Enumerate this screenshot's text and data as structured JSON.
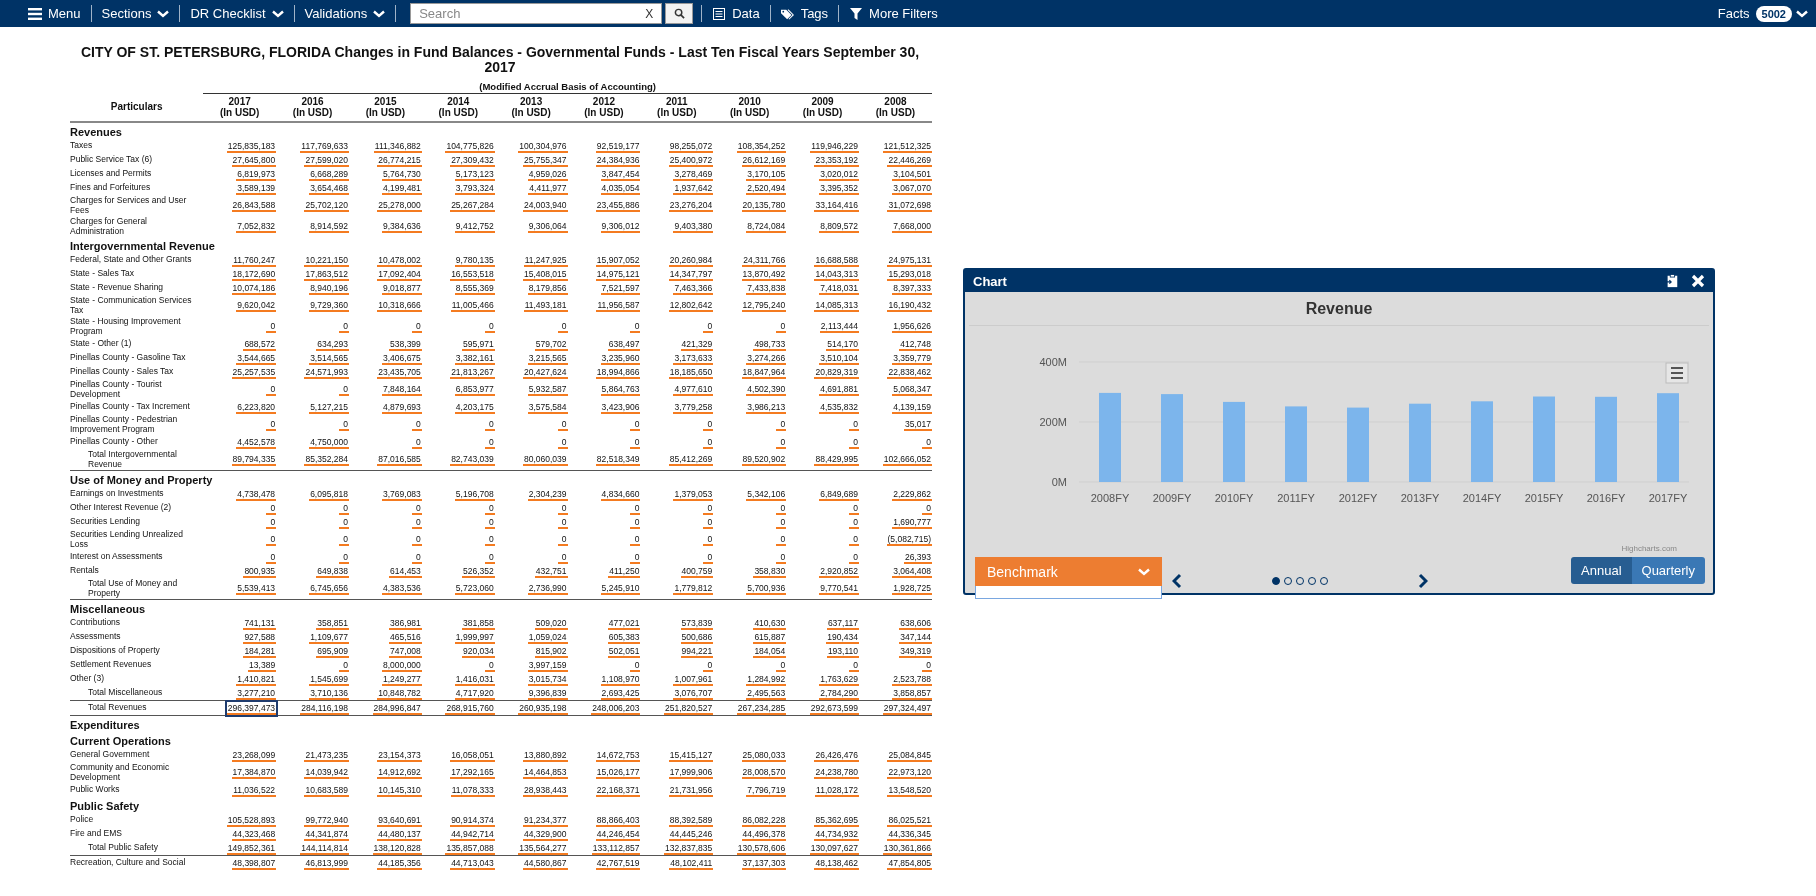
{
  "toolbar": {
    "menu": "Menu",
    "dropdowns": [
      {
        "label": "Sections"
      },
      {
        "label": "DR Checklist"
      },
      {
        "label": "Validations"
      }
    ],
    "search": {
      "placeholder": "Search",
      "clear": "X"
    },
    "links": [
      {
        "kind": "data",
        "label": "Data"
      },
      {
        "kind": "tags",
        "label": "Tags"
      },
      {
        "kind": "filter",
        "label": "More Filters"
      }
    ],
    "facts": {
      "label": "Facts",
      "count": "5002"
    }
  },
  "report": {
    "title": "CITY OF ST. PETERSBURG, FLORIDA Changes in Fund Balances - Governmental Funds - Last Ten Fiscal Years September 30, 2017",
    "subtitle": "(Modified Accrual Basis of Accounting)"
  },
  "table": {
    "label_header": "Particulars",
    "columns": [
      {
        "year": "2017",
        "unit": "(In USD)"
      },
      {
        "year": "2016",
        "unit": "(In USD)"
      },
      {
        "year": "2015",
        "unit": "(In USD)"
      },
      {
        "year": "2014",
        "unit": "(In USD)"
      },
      {
        "year": "2013",
        "unit": "(In USD)"
      },
      {
        "year": "2012",
        "unit": "(In USD)"
      },
      {
        "year": "2011",
        "unit": "(In USD)"
      },
      {
        "year": "2010",
        "unit": "(In USD)"
      },
      {
        "year": "2009",
        "unit": "(In USD)"
      },
      {
        "year": "2008",
        "unit": "(In USD)"
      }
    ],
    "rows": [
      {
        "kind": "section",
        "label": "Revenues"
      },
      {
        "kind": "item",
        "label": "Taxes",
        "selected": false,
        "values": [
          "125,835,183",
          "117,769,633",
          "111,346,882",
          "104,775,826",
          "100,304,976",
          "92,519,177",
          "98,255,072",
          "108,354,252",
          "119,946,229",
          "121,512,325"
        ]
      },
      {
        "kind": "item",
        "label": "Public Service Tax (6)",
        "selected": false,
        "values": [
          "27,645,800",
          "27,599,020",
          "26,774,215",
          "27,309,432",
          "25,755,347",
          "24,384,936",
          "25,400,972",
          "26,612,169",
          "23,353,192",
          "22,446,269"
        ]
      },
      {
        "kind": "item",
        "label": "Licenses and Permits",
        "selected": false,
        "values": [
          "6,819,973",
          "6,668,289",
          "5,764,730",
          "5,173,123",
          "4,959,026",
          "3,847,454",
          "3,278,469",
          "3,170,105",
          "3,020,012",
          "3,104,501"
        ]
      },
      {
        "kind": "item",
        "label": "Fines and Forfeitures",
        "selected": false,
        "values": [
          "3,589,139",
          "3,654,468",
          "4,199,481",
          "3,793,324",
          "4,411,977",
          "4,035,054",
          "1,937,642",
          "2,520,494",
          "3,395,352",
          "3,067,070"
        ]
      },
      {
        "kind": "item",
        "label": "Charges for Services and User Fees",
        "selected": false,
        "values": [
          "26,843,588",
          "25,702,120",
          "25,278,000",
          "25,267,284",
          "24,003,940",
          "23,455,886",
          "23,276,204",
          "20,135,780",
          "33,164,416",
          "31,072,698"
        ]
      },
      {
        "kind": "item",
        "label": "Charges for General Administration",
        "selected": false,
        "values": [
          "7,052,832",
          "8,914,592",
          "9,384,636",
          "9,412,752",
          "9,306,064",
          "9,306,012",
          "9,403,380",
          "8,724,084",
          "8,809,572",
          "7,668,000"
        ]
      },
      {
        "kind": "section",
        "label": "Intergovernmental Revenue"
      },
      {
        "kind": "item",
        "label": "Federal, State and Other Grants",
        "selected": false,
        "values": [
          "11,760,247",
          "10,221,150",
          "10,478,002",
          "9,780,135",
          "11,247,925",
          "15,907,052",
          "20,260,984",
          "24,311,766",
          "16,688,588",
          "24,975,131"
        ]
      },
      {
        "kind": "item",
        "label": "State - Sales Tax",
        "selected": false,
        "values": [
          "18,172,690",
          "17,863,512",
          "17,092,404",
          "16,553,518",
          "15,408,015",
          "14,975,121",
          "14,347,797",
          "13,870,492",
          "14,043,313",
          "15,293,018"
        ]
      },
      {
        "kind": "item",
        "label": "State - Revenue Sharing",
        "selected": false,
        "values": [
          "10,074,186",
          "8,940,196",
          "9,018,877",
          "8,555,369",
          "8,179,856",
          "7,521,597",
          "7,463,366",
          "7,433,838",
          "7,418,031",
          "8,397,333"
        ]
      },
      {
        "kind": "item",
        "label": "State - Communication Services Tax",
        "selected": false,
        "values": [
          "9,620,042",
          "9,729,360",
          "10,318,666",
          "11,005,466",
          "11,493,181",
          "11,956,587",
          "12,802,642",
          "12,795,240",
          "14,085,313",
          "16,190,432"
        ]
      },
      {
        "kind": "item",
        "label": "State - Housing Improvement Program",
        "selected": false,
        "values": [
          "0",
          "0",
          "0",
          "0",
          "0",
          "0",
          "0",
          "0",
          "2,113,444",
          "1,956,626"
        ]
      },
      {
        "kind": "item",
        "label": "State - Other (1)",
        "selected": false,
        "values": [
          "688,572",
          "634,293",
          "538,399",
          "595,971",
          "579,702",
          "638,497",
          "421,329",
          "498,733",
          "514,170",
          "412,748"
        ]
      },
      {
        "kind": "item",
        "label": "Pinellas County - Gasoline Tax",
        "selected": false,
        "values": [
          "3,544,665",
          "3,514,565",
          "3,406,675",
          "3,382,161",
          "3,215,565",
          "3,235,960",
          "3,173,633",
          "3,274,266",
          "3,510,104",
          "3,359,779"
        ]
      },
      {
        "kind": "item",
        "label": "Pinellas County - Sales Tax",
        "selected": false,
        "values": [
          "25,257,535",
          "24,571,993",
          "23,435,705",
          "21,813,267",
          "20,427,624",
          "18,994,866",
          "18,185,650",
          "18,847,964",
          "20,829,319",
          "22,838,462"
        ]
      },
      {
        "kind": "item",
        "label": "Pinellas County - Tourist Development",
        "selected": false,
        "values": [
          "0",
          "0",
          "7,848,164",
          "6,853,977",
          "5,932,587",
          "5,864,763",
          "4,977,610",
          "4,502,390",
          "4,691,881",
          "5,068,347"
        ]
      },
      {
        "kind": "item",
        "label": "Pinellas County - Tax Increment",
        "selected": false,
        "values": [
          "6,223,820",
          "5,127,215",
          "4,879,693",
          "4,203,175",
          "3,575,584",
          "3,423,906",
          "3,779,258",
          "3,986,213",
          "4,535,832",
          "4,139,159"
        ]
      },
      {
        "kind": "item",
        "label": "Pinellas County - Pedestrian Improvement Program",
        "selected": false,
        "values": [
          "0",
          "0",
          "0",
          "0",
          "0",
          "0",
          "0",
          "0",
          "0",
          "35,017"
        ]
      },
      {
        "kind": "item",
        "label": "Pinellas County - Other",
        "selected": false,
        "values": [
          "4,452,578",
          "4,750,000",
          "0",
          "0",
          "0",
          "0",
          "0",
          "0",
          "0",
          "0"
        ]
      },
      {
        "kind": "total",
        "label": "Total Intergovernmental Revenue",
        "selected": false,
        "values": [
          "89,794,335",
          "85,352,284",
          "87,016,585",
          "82,743,039",
          "80,060,039",
          "82,518,349",
          "85,412,269",
          "89,520,902",
          "88,429,995",
          "102,666,052"
        ]
      },
      {
        "kind": "section",
        "label": "Use of Money and Property"
      },
      {
        "kind": "item",
        "label": "Earnings on Investments",
        "selected": false,
        "values": [
          "4,738,478",
          "6,095,818",
          "3,769,083",
          "5,196,708",
          "2,304,239",
          "4,834,660",
          "1,379,053",
          "5,342,106",
          "6,849,689",
          "2,229,862"
        ]
      },
      {
        "kind": "item",
        "label": "Other Interest Revenue (2)",
        "selected": false,
        "values": [
          "0",
          "0",
          "0",
          "0",
          "0",
          "0",
          "0",
          "0",
          "0",
          "0"
        ]
      },
      {
        "kind": "item",
        "label": "Securities Lending",
        "selected": false,
        "values": [
          "0",
          "0",
          "0",
          "0",
          "0",
          "0",
          "0",
          "0",
          "0",
          "1,690,777"
        ]
      },
      {
        "kind": "item",
        "label": "Securities Lending Unrealized Loss",
        "selected": false,
        "values": [
          "0",
          "0",
          "0",
          "0",
          "0",
          "0",
          "0",
          "0",
          "0",
          "(5,082,715)"
        ]
      },
      {
        "kind": "item",
        "label": "Interest on Assessments",
        "selected": false,
        "values": [
          "0",
          "0",
          "0",
          "0",
          "0",
          "0",
          "0",
          "0",
          "0",
          "26,393"
        ]
      },
      {
        "kind": "item",
        "label": "Rentals",
        "selected": false,
        "values": [
          "800,935",
          "649,838",
          "614,453",
          "526,352",
          "432,751",
          "411,250",
          "400,759",
          "358,830",
          "2,920,852",
          "3,064,408"
        ]
      },
      {
        "kind": "total",
        "label": "Total Use of Money and Property",
        "selected": false,
        "values": [
          "5,539,413",
          "6,745,656",
          "4,383,536",
          "5,723,060",
          "2,736,990",
          "5,245,910",
          "1,779,812",
          "5,700,936",
          "9,770,541",
          "1,928,725"
        ]
      },
      {
        "kind": "section",
        "label": "Miscellaneous"
      },
      {
        "kind": "item",
        "label": "Contributions",
        "selected": false,
        "values": [
          "741,131",
          "358,851",
          "386,981",
          "381,858",
          "509,020",
          "477,021",
          "573,839",
          "410,630",
          "637,117",
          "638,606"
        ]
      },
      {
        "kind": "item",
        "label": "Assessments",
        "selected": false,
        "values": [
          "927,588",
          "1,109,677",
          "465,516",
          "1,999,997",
          "1,059,024",
          "605,383",
          "500,686",
          "615,887",
          "190,434",
          "347,144"
        ]
      },
      {
        "kind": "item",
        "label": "Dispositions of Property",
        "selected": false,
        "values": [
          "184,281",
          "695,909",
          "747,008",
          "920,034",
          "815,902",
          "502,051",
          "994,221",
          "184,054",
          "193,110",
          "349,319"
        ]
      },
      {
        "kind": "item",
        "label": "Settlement Revenues",
        "selected": false,
        "values": [
          "13,389",
          "0",
          "8,000,000",
          "0",
          "3,997,159",
          "0",
          "0",
          "0",
          "0",
          "0"
        ]
      },
      {
        "kind": "item",
        "label": "Other (3)",
        "selected": false,
        "values": [
          "1,410,821",
          "1,545,699",
          "1,249,277",
          "1,416,031",
          "3,015,734",
          "1,108,970",
          "1,007,961",
          "1,284,992",
          "1,763,629",
          "2,523,788"
        ]
      },
      {
        "kind": "total",
        "label": "Total Miscellaneous",
        "selected": false,
        "values": [
          "3,277,210",
          "3,710,136",
          "10,848,782",
          "4,717,920",
          "9,396,839",
          "2,693,425",
          "3,076,707",
          "2,495,563",
          "2,784,290",
          "3,858,857"
        ]
      },
      {
        "kind": "total",
        "label": "Total Revenues",
        "selected": true,
        "values": [
          "296,397,473",
          "284,116,198",
          "284,996,847",
          "268,915,760",
          "260,935,198",
          "248,006,203",
          "251,820,527",
          "267,234,285",
          "292,673,599",
          "297,324,497"
        ]
      },
      {
        "kind": "section",
        "label": "Expenditures"
      },
      {
        "kind": "section",
        "label": "Current Operations"
      },
      {
        "kind": "item",
        "label": "General Government",
        "selected": false,
        "values": [
          "23,268,099",
          "21,473,235",
          "23,154,373",
          "16,058,051",
          "13,880,892",
          "14,672,753",
          "15,415,127",
          "25,080,033",
          "26,426,476",
          "25,084,845"
        ]
      },
      {
        "kind": "item",
        "label": "Community and Economic Development",
        "selected": false,
        "values": [
          "17,384,870",
          "14,039,942",
          "14,912,692",
          "17,292,165",
          "14,464,853",
          "15,026,177",
          "17,999,906",
          "28,008,570",
          "24,238,780",
          "22,973,120"
        ]
      },
      {
        "kind": "item",
        "label": "Public Works",
        "selected": false,
        "values": [
          "11,036,522",
          "10,683,589",
          "10,145,310",
          "11,078,333",
          "28,938,443",
          "22,168,371",
          "21,731,956",
          "7,796,719",
          "11,028,172",
          "13,548,520"
        ]
      },
      {
        "kind": "section",
        "label": "Public Safety"
      },
      {
        "kind": "item",
        "label": "Police",
        "selected": false,
        "values": [
          "105,528,893",
          "99,772,940",
          "93,640,691",
          "90,914,374",
          "91,234,377",
          "88,866,403",
          "88,392,589",
          "86,082,228",
          "85,362,695",
          "86,025,521"
        ]
      },
      {
        "kind": "item",
        "label": "Fire and EMS",
        "selected": false,
        "values": [
          "44,323,468",
          "44,341,874",
          "44,480,137",
          "44,942,714",
          "44,329,900",
          "44,246,454",
          "44,445,246",
          "44,496,378",
          "44,734,932",
          "44,336,345"
        ]
      },
      {
        "kind": "total",
        "label": "Total Public Safety",
        "selected": false,
        "values": [
          "149,852,361",
          "144,114,814",
          "138,120,828",
          "135,857,088",
          "135,564,277",
          "133,112,857",
          "132,837,835",
          "130,578,606",
          "130,097,627",
          "130,361,866"
        ]
      },
      {
        "kind": "item",
        "label": "Recreation, Culture and Social",
        "selected": false,
        "values": [
          "48,398,807",
          "46,813,999",
          "44,185,356",
          "44,713,043",
          "44,580,867",
          "42,767,519",
          "48,102,411",
          "37,137,303",
          "48,138,462",
          "47,854,805"
        ]
      }
    ]
  },
  "chart_panel": {
    "title": "Chart",
    "chart_data": {
      "type": "bar",
      "title": "Revenue",
      "categories": [
        "2008FY",
        "2009FY",
        "2010FY",
        "2011FY",
        "2012FY",
        "2013FY",
        "2014FY",
        "2015FY",
        "2016FY",
        "2017FY"
      ],
      "series": [
        {
          "color": "#7cb5ec",
          "values": [
            297,
            293,
            267,
            252,
            248,
            261,
            269,
            285,
            284,
            296
          ]
        }
      ],
      "ylim": [
        0,
        400
      ],
      "yticks": [
        {
          "value": 0,
          "label": "0M"
        },
        {
          "value": 200,
          "label": "200M"
        },
        {
          "value": 400,
          "label": "400M"
        }
      ]
    },
    "credit": "Highcharts.com",
    "benchmark": "Benchmark",
    "pages": [
      {
        "selected": true
      },
      {
        "selected": false
      },
      {
        "selected": false
      },
      {
        "selected": false
      },
      {
        "selected": false
      }
    ],
    "periods": [
      {
        "label": "Annual",
        "selected": true
      },
      {
        "label": "Quarterly",
        "selected": false
      }
    ]
  }
}
